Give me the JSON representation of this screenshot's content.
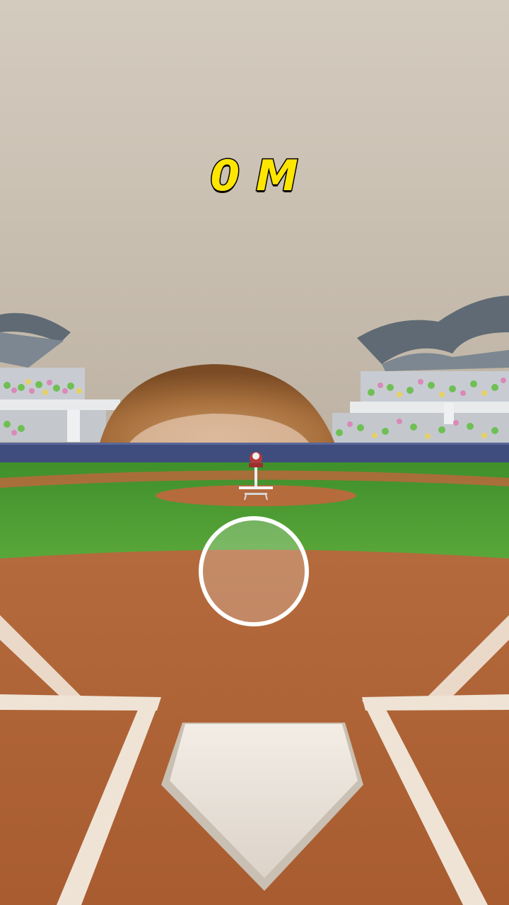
{
  "hud": {
    "distance_label": "0 M"
  },
  "colors": {
    "distance_text": "#ffe600",
    "distance_outline": "#000000",
    "reticle_ring": "#ffffff",
    "grass": "#4f9f35",
    "dirt": "#b8683a",
    "chalk": "#efe3d6",
    "wall": "#3f4d7e",
    "sky_backdrop": "#cfc5b7"
  },
  "icons": {
    "reticle": "target-ring-icon",
    "pitcher": "pitching-machine-icon",
    "plate": "home-plate-icon"
  }
}
